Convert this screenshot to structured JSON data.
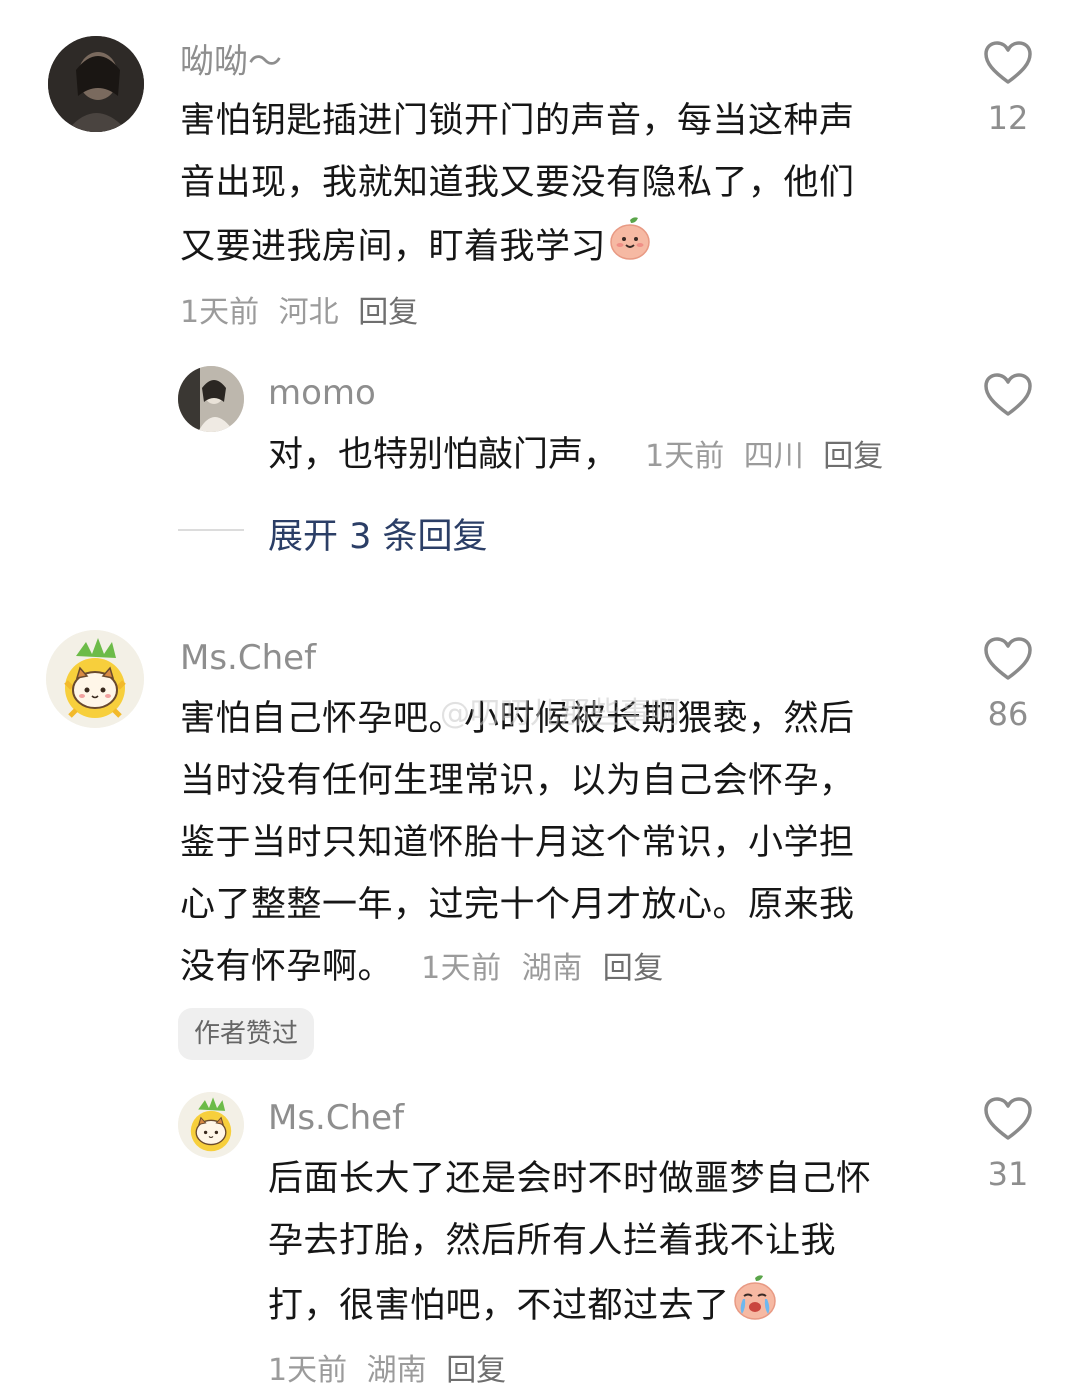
{
  "comments": [
    {
      "username": "呦呦～",
      "lines": [
        "害怕钥匙插进门锁开门的声音，每当这种声",
        "音出现，我就知道我又要没有隐私了，他们",
        "又要进我房间，盯着我学习"
      ],
      "time": "1天前",
      "location": "河北",
      "reply_label": "回复",
      "likes": "12"
    },
    {
      "username": "momo",
      "text": "对，也特别怕敲门声，",
      "time": "1天前",
      "location": "四川",
      "reply_label": "回复"
    },
    {
      "username": "Ms.Chef",
      "lines": [
        "害怕自己怀孕吧。小时候被长期猥亵，然后",
        "当时没有任何生理常识，以为自己会怀孕，",
        "鉴于当时只知道怀胎十月这个常识，小学担",
        "心了整整一年，过完十个月才放心。原来我",
        "没有怀孕啊。"
      ],
      "time": "1天前",
      "location": "湖南",
      "reply_label": "回复",
      "likes": "86",
      "badge": "作者赞过"
    },
    {
      "username": "Ms.Chef",
      "lines": [
        "后面长大了还是会时不时做噩梦自己怀",
        "孕去打胎，然后所有人拦着我不让我",
        "打，很害怕吧，不过都过去了"
      ],
      "time": "1天前",
      "location": "湖南",
      "reply_label": "回复",
      "likes": "31"
    }
  ],
  "expand_replies": "展开 3 条回复",
  "watermark": "@叨叨儿那些事啊",
  "colors": {
    "text": "#161616",
    "meta": "#9b9b9b",
    "expand_link": "#2b3e66",
    "badge_bg": "#efefef"
  },
  "icons": {
    "like": "heart-outline-icon",
    "emoji_smile": "peach-smile-emoji",
    "emoji_cry": "peach-cry-emoji"
  }
}
